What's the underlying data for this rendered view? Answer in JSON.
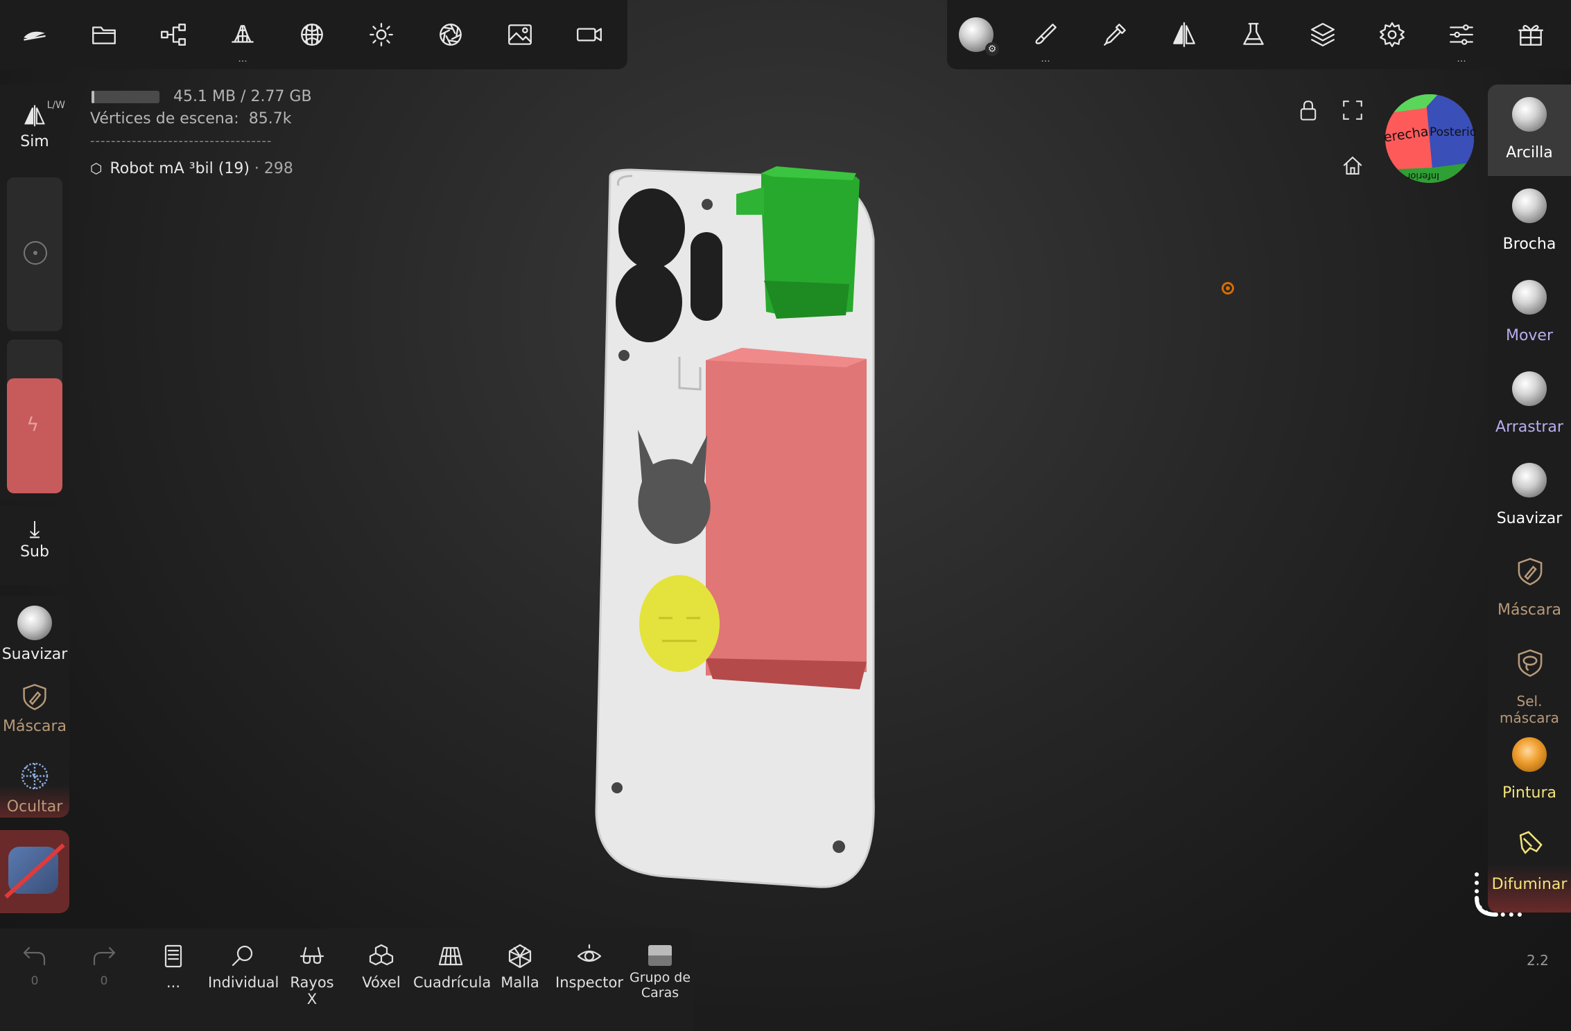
{
  "top_toolbar_left": [
    {
      "icon": "nomad-logo-icon"
    },
    {
      "icon": "folder-icon"
    },
    {
      "icon": "scene-graph-icon"
    },
    {
      "icon": "primitives-icon",
      "more": "..."
    },
    {
      "icon": "material-sphere-icon"
    },
    {
      "icon": "light-icon"
    },
    {
      "icon": "camera-aperture-icon"
    },
    {
      "icon": "image-icon"
    },
    {
      "icon": "video-icon"
    }
  ],
  "top_toolbar_right": [
    {
      "icon": "material-ball-icon"
    },
    {
      "icon": "paint-brush-icon",
      "more": "..."
    },
    {
      "icon": "eyedropper-icon"
    },
    {
      "icon": "symmetry-icon"
    },
    {
      "icon": "flask-icon"
    },
    {
      "icon": "layers-icon"
    },
    {
      "icon": "settings-gear-icon"
    },
    {
      "icon": "sliders-icon",
      "more": "..."
    },
    {
      "icon": "gift-icon"
    }
  ],
  "stats": {
    "memory": "45.1 MB / 2.77 GB",
    "vertices_label": "Vértices de escena",
    "vertices_value": "85.7k",
    "separator": "-----------------------------------",
    "object_name": "Robot mA ³bil (19)",
    "object_count": "298"
  },
  "left_panel": {
    "sym_badge": "L/W",
    "sym_label": "Sim",
    "sub_label": "Sub",
    "smooth_label": "Suavizar",
    "mask_label": "Máscara",
    "hide_label": "Ocultar"
  },
  "right_tools": [
    {
      "label": "Arcilla",
      "color": "#ffffff",
      "active": true
    },
    {
      "label": "Brocha",
      "color": "#ffffff"
    },
    {
      "label": "Mover",
      "color": "#b7aef0"
    },
    {
      "label": "Arrastrar",
      "color": "#b7aef0"
    },
    {
      "label": "Suavizar",
      "color": "#ffffff"
    },
    {
      "label": "Máscara",
      "color": "#b89a7a"
    },
    {
      "label": "Sel. máscara",
      "color": "#b89a7a"
    },
    {
      "label": "Pintura",
      "color": "#f2e47a"
    },
    {
      "label": "Difuminar",
      "color": "#f2e47a"
    }
  ],
  "gizmo": {
    "right_label": "Derecha",
    "back_label": "Posterior",
    "bottom_label": "Inferior"
  },
  "bottom_bar": {
    "undo_count": "0",
    "redo_count": "0",
    "items": [
      {
        "label": "...",
        "icon": "book-icon"
      },
      {
        "label": "Individual",
        "icon": "search-icon"
      },
      {
        "label": "Rayos X",
        "icon": "xray-glasses-icon"
      },
      {
        "label": "Vóxel",
        "icon": "voxel-cubes-icon"
      },
      {
        "label": "Cuadrícula",
        "icon": "grid-floor-icon"
      },
      {
        "label": "Malla",
        "icon": "wireframe-icon"
      },
      {
        "label": "Inspector",
        "icon": "eye-icon"
      },
      {
        "label": "Grupo de\nCaras",
        "icon": "facegroup-icon"
      }
    ]
  },
  "zoom_value": "2.2"
}
